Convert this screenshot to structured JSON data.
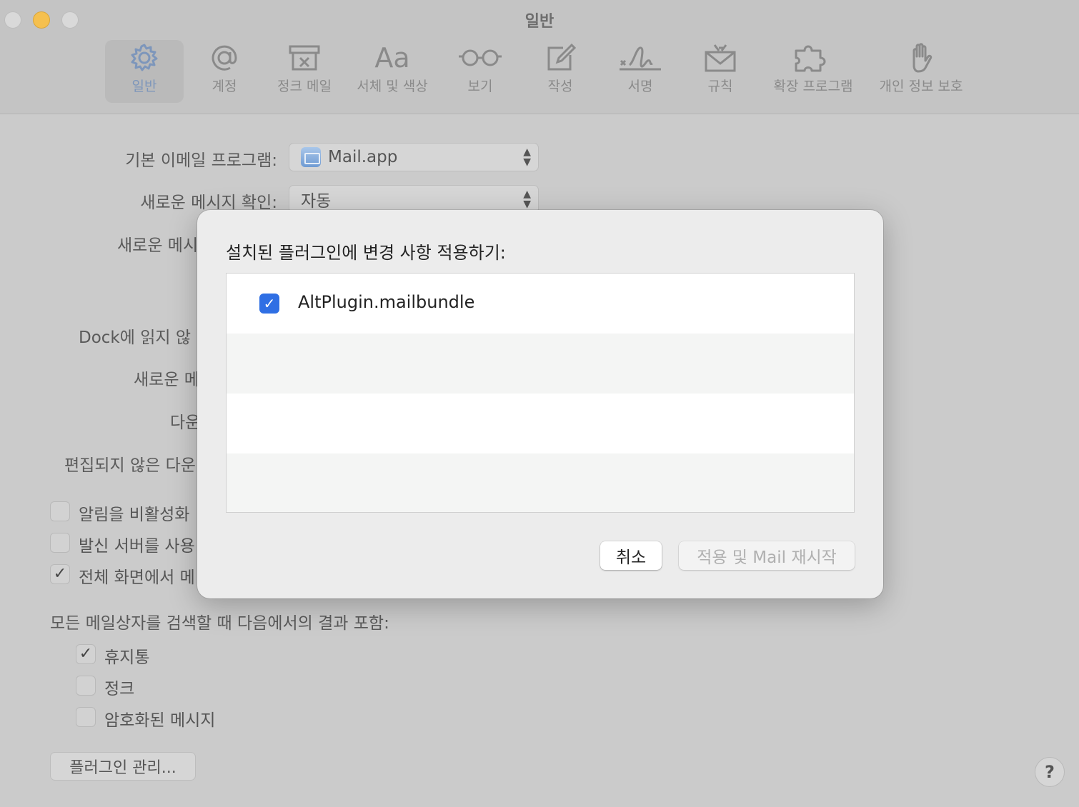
{
  "window": {
    "title": "일반"
  },
  "toolbar": {
    "items": [
      {
        "label": "일반",
        "icon": "gear-icon"
      },
      {
        "label": "계정",
        "icon": "at-icon"
      },
      {
        "label": "정크 메일",
        "icon": "junk-box-icon"
      },
      {
        "label": "서체 및 색상",
        "icon": "font-aa-icon"
      },
      {
        "label": "보기",
        "icon": "glasses-icon"
      },
      {
        "label": "작성",
        "icon": "compose-icon"
      },
      {
        "label": "서명",
        "icon": "signature-icon"
      },
      {
        "label": "규칙",
        "icon": "rules-envelope-icon"
      },
      {
        "label": "확장 프로그램",
        "icon": "puzzle-icon"
      },
      {
        "label": "개인 정보 보호",
        "icon": "hand-icon"
      }
    ],
    "active": "일반"
  },
  "settings": {
    "default_mail_label": "기본 이메일 프로그램:",
    "default_mail_value": "Mail.app",
    "check_new_label": "새로운 메시지 확인:",
    "check_new_value": "자동",
    "new_msg_sound_label": "새로운 메시",
    "dock_unread_label": "Dock에 읽지 않",
    "new_msg_notify_label": "새로운 메",
    "download_label": "다운",
    "remove_unedited_label": "편집되지 않은 다운",
    "checkboxes": [
      {
        "label": "알림을 비활성화",
        "checked": false
      },
      {
        "label": "발신 서버를 사용",
        "checked": false
      },
      {
        "label": "전체 화면에서 메",
        "checked": true
      }
    ],
    "search_include_label": "모든 메일상자를 검색할 때 다음에서의 결과 포함:",
    "search_options": [
      {
        "label": "휴지통",
        "checked": true
      },
      {
        "label": "정크",
        "checked": false
      },
      {
        "label": "암호화된 메시지",
        "checked": false
      }
    ],
    "manage_plugins_label": "플러그인 관리...",
    "help_label": "?"
  },
  "sheet": {
    "title": "설치된 플러그인에 변경 사항 적용하기:",
    "plugins": [
      {
        "name": "AltPlugin.mailbundle",
        "checked": true
      }
    ],
    "cancel_label": "취소",
    "apply_label": "적용 및 Mail 재시작"
  },
  "colors": {
    "accent": "#2f6fe4",
    "minimize": "#f5c04f"
  }
}
